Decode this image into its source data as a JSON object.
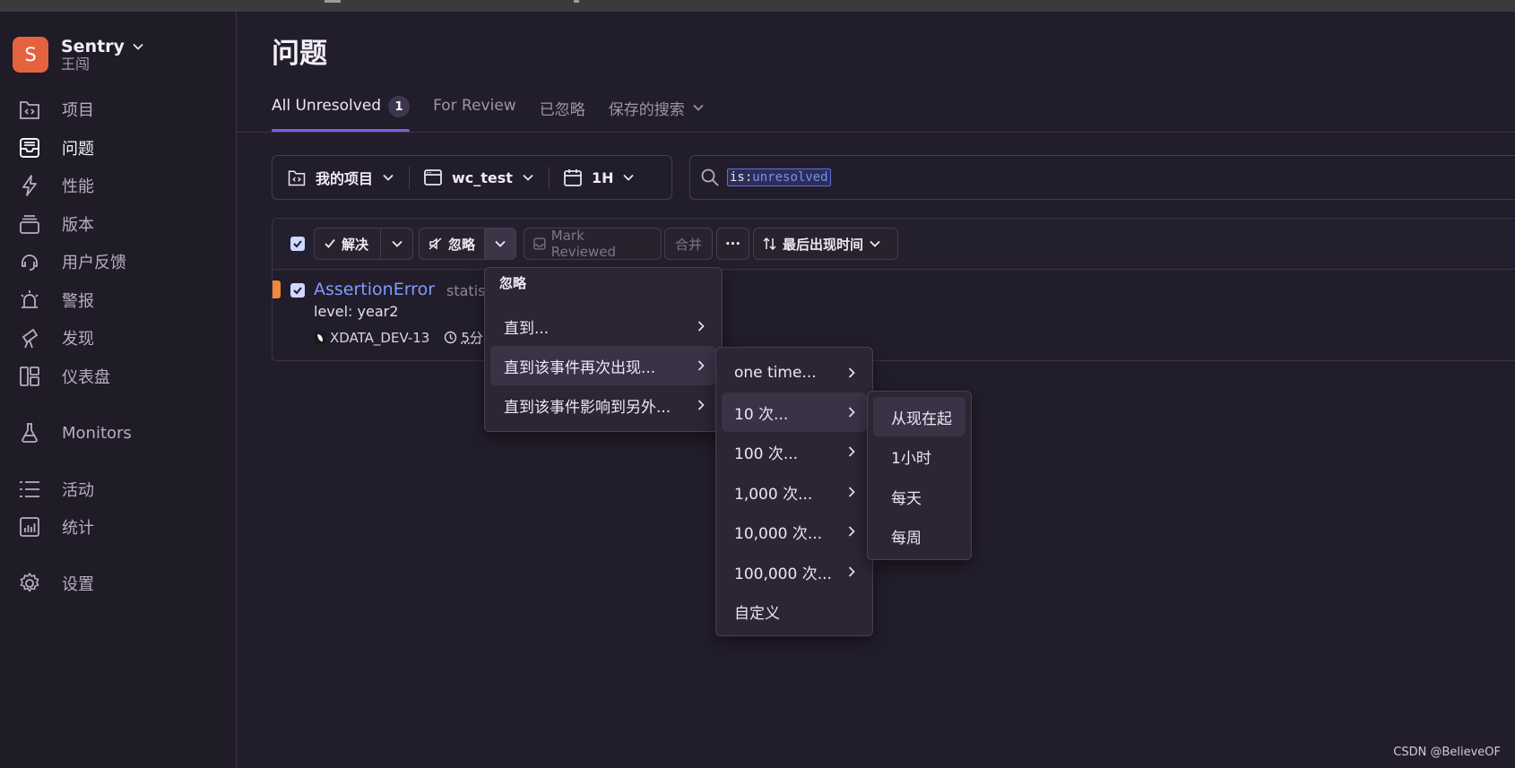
{
  "sidebar": {
    "org_initial": "S",
    "org_name": "Sentry",
    "org_user": "王闯",
    "items": [
      {
        "label": "项目",
        "icon": "projects-icon"
      },
      {
        "label": "问题",
        "icon": "issues-icon",
        "active": true
      },
      {
        "label": "性能",
        "icon": "performance-icon"
      },
      {
        "label": "版本",
        "icon": "releases-icon"
      },
      {
        "label": "用户反馈",
        "icon": "user-feedback-icon"
      },
      {
        "label": "警报",
        "icon": "alerts-icon"
      },
      {
        "label": "发现",
        "icon": "discover-icon"
      },
      {
        "label": "仪表盘",
        "icon": "dashboards-icon"
      },
      {
        "label": "Monitors",
        "icon": "monitors-icon"
      },
      {
        "label": "活动",
        "icon": "activity-icon"
      },
      {
        "label": "统计",
        "icon": "stats-icon"
      },
      {
        "label": "设置",
        "icon": "settings-icon"
      }
    ]
  },
  "page": {
    "title": "问题",
    "tabs": [
      {
        "label": "All Unresolved",
        "count": "1",
        "active": true
      },
      {
        "label": "For Review"
      },
      {
        "label": "已忽略"
      },
      {
        "label": "保存的搜索"
      }
    ]
  },
  "filters": {
    "project": "我的项目",
    "environment": "wc_test",
    "period": "1H"
  },
  "search": {
    "token_key": "is:",
    "token_value": "unresolved"
  },
  "toolbar": {
    "resolve": "解决",
    "ignore": "忽略",
    "mark_reviewed": "Mark Reviewed",
    "merge": "合并",
    "more": "···",
    "sort": "最后出现时间"
  },
  "issue": {
    "title": "AssertionError",
    "culprit": "statis",
    "message": "level: year2",
    "short_id": "XDATA_DEV-13",
    "age": "5分"
  },
  "ignore_menu": {
    "header": "忽略",
    "items": [
      "直到...",
      "直到该事件再次出现...",
      "直到该事件影响到另外..."
    ]
  },
  "count_menu": {
    "items": [
      "one time...",
      "10 次...",
      "100 次...",
      "1,000 次...",
      "10,000 次...",
      "100,000 次...",
      "自定义"
    ]
  },
  "window_menu": {
    "items": [
      "从现在起",
      "1小时",
      "每天",
      "每周"
    ]
  },
  "colors": {
    "accent": "#7a5ee0",
    "link": "#7f9cff",
    "org_avatar": "#e5623f",
    "issue_level": "#f0883a"
  },
  "watermark": "CSDN @BelieveOF"
}
